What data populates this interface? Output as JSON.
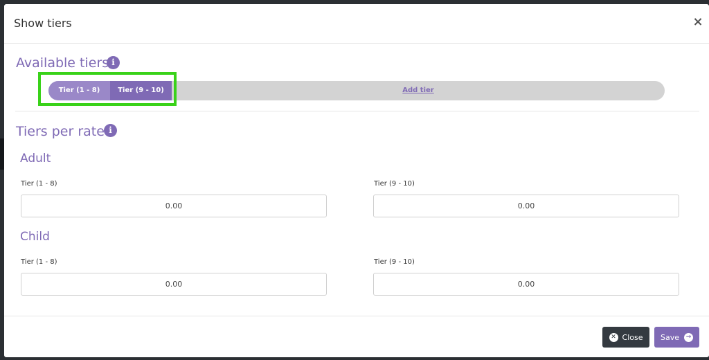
{
  "modal": {
    "title": "Show tiers",
    "close_glyph": "×"
  },
  "available_tiers": {
    "title": "Available tiers",
    "info_glyph": "i",
    "tiers": [
      {
        "label": "Tier (1 - 8)"
      },
      {
        "label": "Tier (9 - 10)"
      }
    ],
    "add_label": "Add tier"
  },
  "tiers_per_rate": {
    "title": "Tiers per rate",
    "info_glyph": "i",
    "groups": [
      {
        "name": "Adult",
        "fields": [
          {
            "label": "Tier (1 - 8)",
            "value": "0.00"
          },
          {
            "label": "Tier (9 - 10)",
            "value": "0.00"
          }
        ]
      },
      {
        "name": "Child",
        "fields": [
          {
            "label": "Tier (1 - 8)",
            "value": "0.00"
          },
          {
            "label": "Tier (9 - 10)",
            "value": "0.00"
          }
        ]
      }
    ]
  },
  "footer": {
    "close_label": "Close",
    "close_icon": "x-circle-icon",
    "close_glyph": "✕",
    "save_label": "Save",
    "save_icon": "arrow-right-circle-icon",
    "save_glyph": "→"
  },
  "colors": {
    "accent": "#7f6ab5",
    "accent_light": "#9a88c8",
    "highlight": "#39d219",
    "dark_button": "#343a40"
  }
}
